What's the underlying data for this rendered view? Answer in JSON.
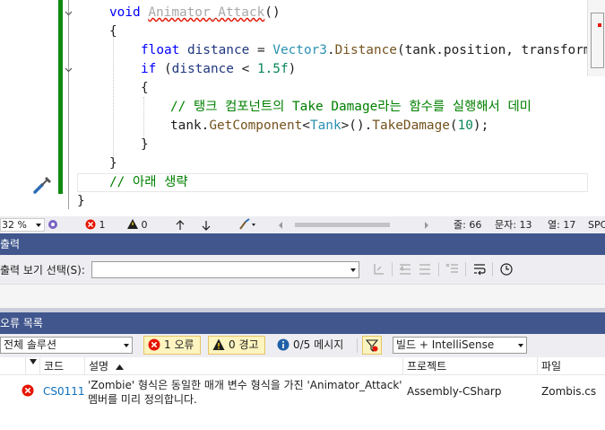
{
  "editor": {
    "lines": [
      {
        "tokens": [
          {
            "t": "void ",
            "c": "kw"
          },
          {
            "t": "Animator_Attack",
            "c": "err"
          },
          {
            "t": "()",
            "c": ""
          }
        ]
      },
      {
        "tokens": [
          {
            "t": "{",
            "c": ""
          }
        ]
      },
      {
        "tokens": [
          {
            "t": "float ",
            "c": "kw"
          },
          {
            "t": "distance",
            "c": "pl"
          },
          {
            "t": " = ",
            "c": ""
          },
          {
            "t": "Vector3",
            "c": "ty"
          },
          {
            "t": ".",
            "c": ""
          },
          {
            "t": "Distance",
            "c": "mth"
          },
          {
            "t": "(tank.position, transform",
            "c": ""
          }
        ]
      },
      {
        "tokens": [
          {
            "t": "if",
            "c": "kw"
          },
          {
            "t": " (",
            "c": ""
          },
          {
            "t": "distance",
            "c": "pl"
          },
          {
            "t": " < ",
            "c": ""
          },
          {
            "t": "1.5f",
            "c": "nm"
          },
          {
            "t": ")",
            "c": ""
          }
        ]
      },
      {
        "tokens": [
          {
            "t": "{",
            "c": ""
          }
        ]
      },
      {
        "tokens": [
          {
            "t": "// 탱크 컴포넌트의 Take Damage라는 함수를 실행해서 데미",
            "c": "cm"
          }
        ]
      },
      {
        "tokens": [
          {
            "t": "tank.",
            "c": ""
          },
          {
            "t": "GetComponent",
            "c": "mth"
          },
          {
            "t": "<",
            "c": ""
          },
          {
            "t": "Tank",
            "c": "ty"
          },
          {
            "t": ">().",
            "c": ""
          },
          {
            "t": "TakeDamage",
            "c": "mth"
          },
          {
            "t": "(",
            "c": ""
          },
          {
            "t": "10",
            "c": "nm"
          },
          {
            "t": ");",
            "c": ""
          }
        ]
      },
      {
        "tokens": [
          {
            "t": "}",
            "c": ""
          }
        ]
      },
      {
        "tokens": [
          {
            "t": "}",
            "c": ""
          }
        ]
      },
      {
        "tokens": [
          {
            "t": "// 아래 생략",
            "c": "cm"
          }
        ]
      },
      {
        "tokens": [
          {
            "t": "}",
            "c": ""
          }
        ]
      }
    ]
  },
  "status": {
    "zoom": "32 %",
    "errors": "1",
    "warnings": "0",
    "line": "줄: 66",
    "char": "문자: 13",
    "col": "열: 17",
    "spc": "SPC"
  },
  "output_panel": {
    "title": "출력",
    "show_output_label": "출력 보기 선택(S):",
    "source_value": ""
  },
  "error_panel": {
    "title": "오류 목록",
    "scope": "전체 솔루션",
    "errors_btn": "1 오류",
    "warnings_btn": "0 경고",
    "messages_btn": "0/5 메시지",
    "build_filter": "빌드 + IntelliSense",
    "columns": {
      "code": "코드",
      "description": "설명",
      "project": "프로젝트",
      "file": "파일"
    },
    "rows": [
      {
        "code": "CS0111",
        "description_line1": "'Zombie' 형식은 동일한 매개 변수 형식을 가진 'Animator_Attack'",
        "description_line2": "멤버를 미리 정의합니다.",
        "project": "Assembly-CSharp",
        "file": "Zombis.cs"
      }
    ]
  },
  "colors": {
    "panel_title_bg": "#40568d",
    "error_red": "#e51400",
    "link_blue": "#0e70c0",
    "change_green": "#118a11"
  }
}
